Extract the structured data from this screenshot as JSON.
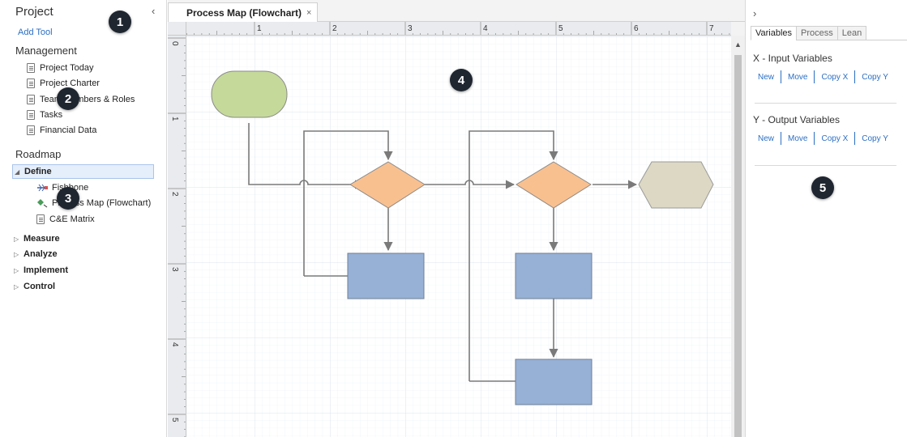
{
  "left_panel": {
    "title": "Project",
    "collapse_glyph": "‹",
    "add_tool": "Add Tool",
    "management_heading": "Management",
    "management_items": [
      "Project Today",
      "Project Charter",
      "Team Members & Roles",
      "Tasks",
      "Financial Data"
    ],
    "roadmap_heading": "Roadmap",
    "phases": {
      "define": "Define",
      "measure": "Measure",
      "analyze": "Analyze",
      "implement": "Implement",
      "control": "Control"
    },
    "define_items": [
      "Fishbone",
      "Process Map (Flowchart)",
      "C&E Matrix"
    ]
  },
  "tab": {
    "label": "Process Map (Flowchart)",
    "close_glyph": "×"
  },
  "ruler": {
    "top_labels": [
      "1",
      "2",
      "3",
      "4",
      "5",
      "6",
      "7"
    ],
    "left_labels": [
      "0",
      "1",
      "2",
      "3",
      "4",
      "5"
    ]
  },
  "right_panel": {
    "expand_glyph": "›",
    "tabs": [
      "Variables",
      "Process",
      "Lean"
    ],
    "active_tab": "Variables",
    "x_heading": "X - Input Variables",
    "x_actions": [
      "New",
      "Move",
      "Copy X",
      "Copy Y"
    ],
    "y_heading": "Y - Output Variables",
    "y_actions": [
      "New",
      "Move",
      "Copy X",
      "Copy Y"
    ]
  },
  "badges": [
    "1",
    "2",
    "3",
    "4",
    "5"
  ],
  "colors": {
    "start_shape": "#c5d99a",
    "decision": "#f9c08f",
    "process": "#97b1d6",
    "end_shape": "#ddd8c4",
    "connector": "#7a7a7a",
    "link": "#2b6fc4",
    "badge": "#1f2630"
  },
  "icons": {
    "collapse": "chevron-left-icon",
    "expand": "chevron-right-icon",
    "document": "document-icon",
    "fishbone": "fishbone-icon",
    "process_map": "process-map-icon"
  }
}
